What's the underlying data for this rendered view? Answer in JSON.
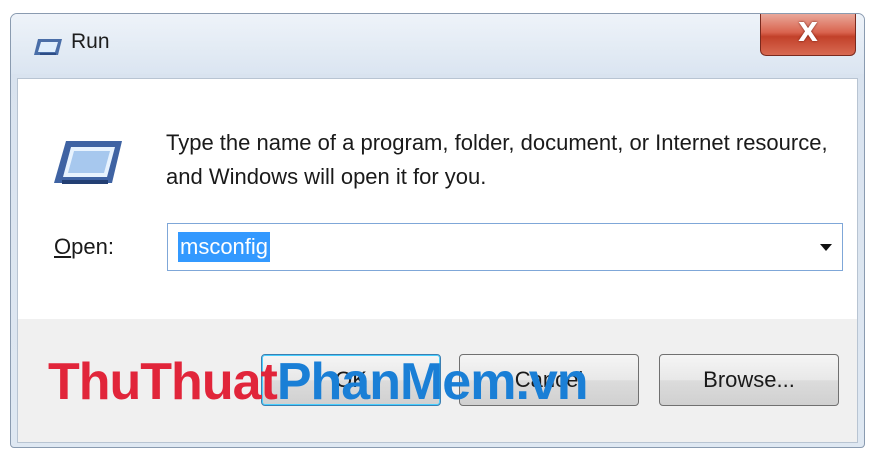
{
  "window": {
    "title": "Run",
    "close_label": "X"
  },
  "dialog": {
    "description": "Type the name of a program, folder, document, or Internet resource, and Windows will open it for you.",
    "open_label_accel": "O",
    "open_label_rest": "pen:",
    "open_value": "msconfig"
  },
  "buttons": {
    "ok": "OK",
    "cancel": "Cancel",
    "browse": "Browse..."
  },
  "watermark": {
    "part1": "ThuThuat",
    "part2": "PhanMem",
    "part3": ".vn"
  },
  "colors": {
    "selection": "#3399ff",
    "close_button": "#c2412a",
    "watermark_red": "#e1253a",
    "watermark_blue": "#1a7fd6"
  },
  "icons": {
    "title": "run-icon",
    "body": "run-icon",
    "dropdown": "chevron-down-icon"
  }
}
